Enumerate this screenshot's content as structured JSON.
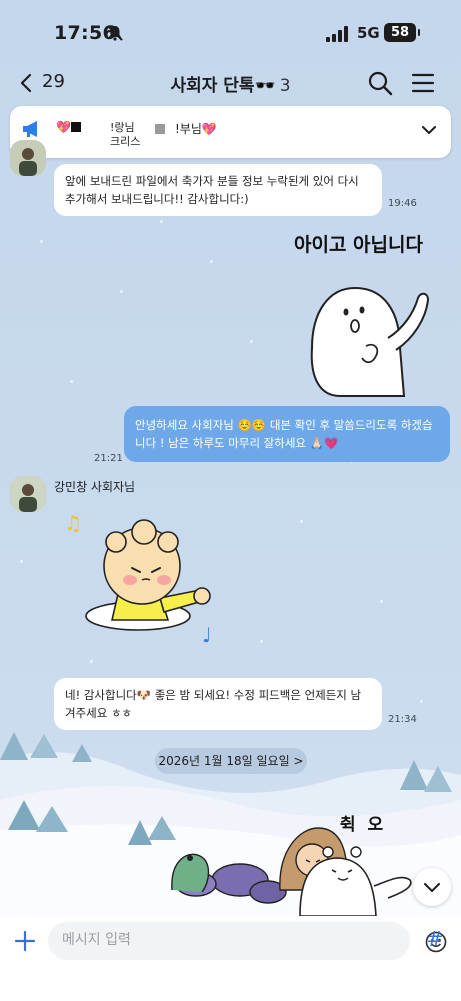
{
  "status_bar": {
    "time": "17:56",
    "network": "5G",
    "battery": "58"
  },
  "header": {
    "back_count": "29",
    "chat_title": "사회자 단톡🕶️",
    "member_count": "3"
  },
  "notice": {
    "text1": "💖",
    "text2_line1": "!랑님",
    "text2_line2": "크리스",
    "text3": "!부님💖"
  },
  "messages": [
    {
      "type": "incoming",
      "text": "앞에 보내드린 파일에서 축가자 분들 정보 누락된게 있어 다시 추가해서 보내드립니다!! 감사합니다:)",
      "time": "19:46"
    },
    {
      "type": "sticker",
      "text": "아이고 아닙니다"
    },
    {
      "type": "outgoing",
      "text": "안녕하세요 사회자님 ☺️☺️ 대본 확인 후 말씀드리도록 하겠습니다 ! 남은 하루도 마무리 잘하세요 🙏🏻💗",
      "time": "21:21"
    },
    {
      "type": "incoming",
      "sender": "강민창 사회자님"
    },
    {
      "type": "incoming",
      "text": "네! 감사합니다🐶 좋은 밤 되세요! 수정 피드백은 언제든지 남겨주세요 ㅎㅎ",
      "time": "21:34"
    }
  ],
  "date_divider": "2026년 1월 18일 일요일 >",
  "sticker_bottom_text": "췩  오",
  "composer": {
    "placeholder": "메시지 입력"
  },
  "colors": {
    "background": "#c8d9ec",
    "outgoing_bubble": "#6fa8e8",
    "accent": "#3a6fd8"
  }
}
